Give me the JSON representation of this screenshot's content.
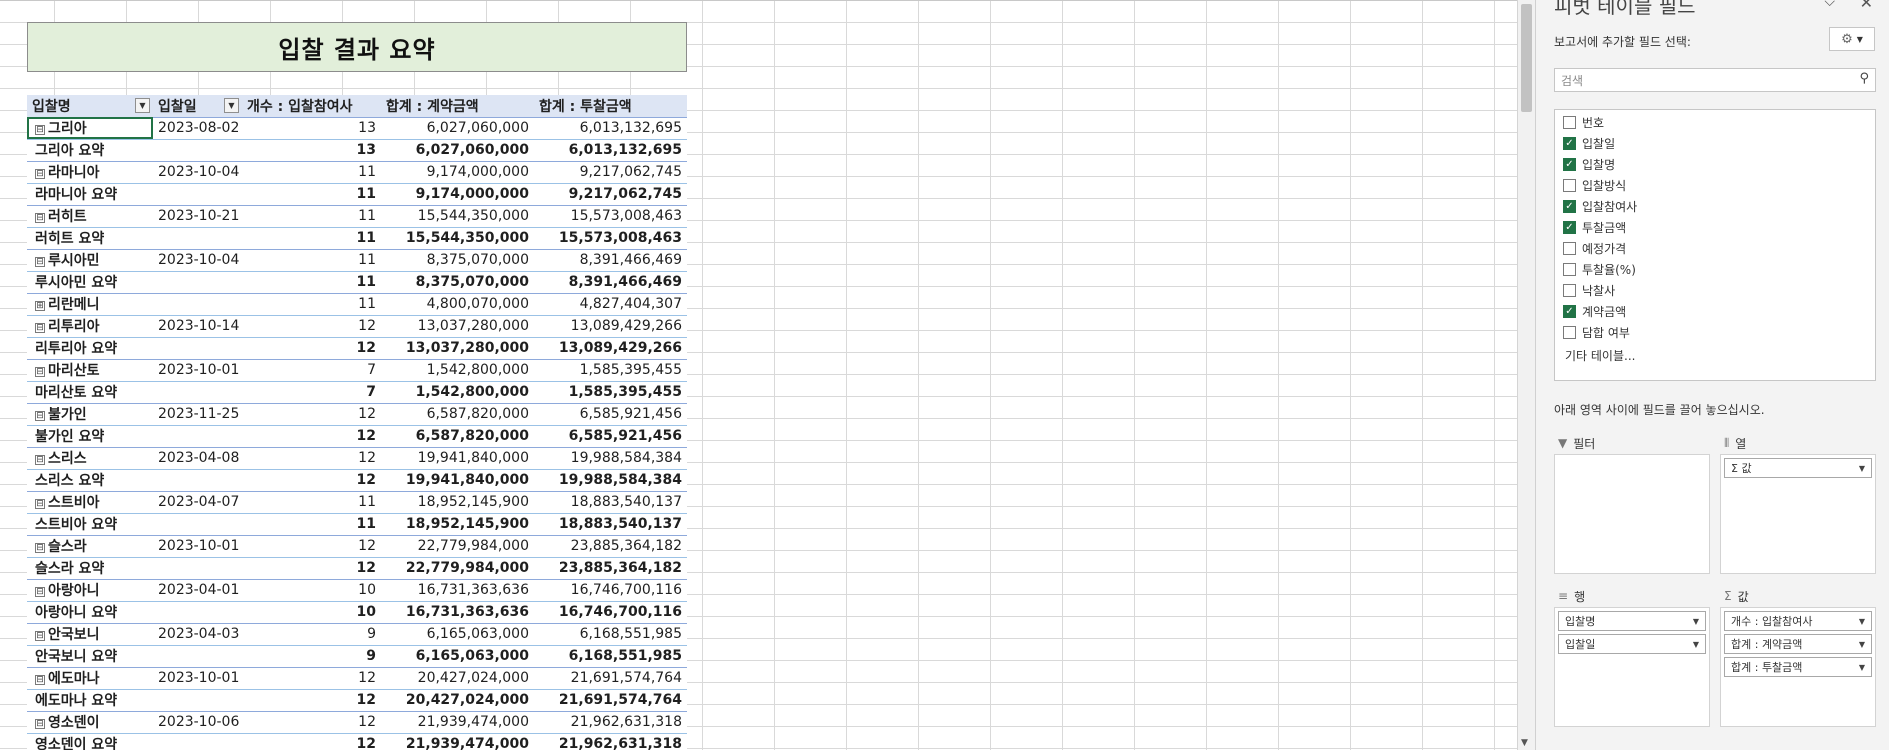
{
  "sheet": {
    "title": "입찰 결과 요약",
    "headers": [
      "입찰명",
      "입찰일",
      "개수 : 입찰참여사",
      "합계 : 계약금액",
      "합계 : 투찰금액"
    ],
    "rows": [
      {
        "type": "detail",
        "name": "그리아",
        "exp": "⊟",
        "date": "2023-08-02",
        "count": "13",
        "contract": "6,027,060,000",
        "bid": "6,013,132,695"
      },
      {
        "type": "sub",
        "name": "그리아 요약",
        "count": "13",
        "contract": "6,027,060,000",
        "bid": "6,013,132,695"
      },
      {
        "type": "detail",
        "name": "라마니아",
        "exp": "⊟",
        "date": "2023-10-04",
        "count": "11",
        "contract": "9,174,000,000",
        "bid": "9,217,062,745"
      },
      {
        "type": "sub",
        "name": "라마니아 요약",
        "count": "11",
        "contract": "9,174,000,000",
        "bid": "9,217,062,745"
      },
      {
        "type": "detail",
        "name": "러히트",
        "exp": "⊟",
        "date": "2023-10-21",
        "count": "11",
        "contract": "15,544,350,000",
        "bid": "15,573,008,463"
      },
      {
        "type": "sub",
        "name": "러히트 요약",
        "count": "11",
        "contract": "15,544,350,000",
        "bid": "15,573,008,463"
      },
      {
        "type": "detail",
        "name": "루시아민",
        "exp": "⊟",
        "date": "2023-10-04",
        "count": "11",
        "contract": "8,375,070,000",
        "bid": "8,391,466,469"
      },
      {
        "type": "sub",
        "name": "루시아민 요약",
        "count": "11",
        "contract": "8,375,070,000",
        "bid": "8,391,466,469"
      },
      {
        "type": "detail",
        "name": "리란메니",
        "exp": "⊞",
        "date": "",
        "count": "11",
        "contract": "4,800,070,000",
        "bid": "4,827,404,307"
      },
      {
        "type": "detail",
        "name": "리투리아",
        "exp": "⊟",
        "date": "2023-10-14",
        "count": "12",
        "contract": "13,037,280,000",
        "bid": "13,089,429,266"
      },
      {
        "type": "sub",
        "name": "리투리아 요약",
        "count": "12",
        "contract": "13,037,280,000",
        "bid": "13,089,429,266"
      },
      {
        "type": "detail",
        "name": "마리산토",
        "exp": "⊟",
        "date": "2023-10-01",
        "count": "7",
        "contract": "1,542,800,000",
        "bid": "1,585,395,455"
      },
      {
        "type": "sub",
        "name": "마리산토 요약",
        "count": "7",
        "contract": "1,542,800,000",
        "bid": "1,585,395,455"
      },
      {
        "type": "detail",
        "name": "불가인",
        "exp": "⊟",
        "date": "2023-11-25",
        "count": "12",
        "contract": "6,587,820,000",
        "bid": "6,585,921,456"
      },
      {
        "type": "sub",
        "name": "불가인 요약",
        "count": "12",
        "contract": "6,587,820,000",
        "bid": "6,585,921,456"
      },
      {
        "type": "detail",
        "name": "스리스",
        "exp": "⊟",
        "date": "2023-04-08",
        "count": "12",
        "contract": "19,941,840,000",
        "bid": "19,988,584,384"
      },
      {
        "type": "sub",
        "name": "스리스 요약",
        "count": "12",
        "contract": "19,941,840,000",
        "bid": "19,988,584,384"
      },
      {
        "type": "detail",
        "name": "스트비아",
        "exp": "⊟",
        "date": "2023-04-07",
        "count": "11",
        "contract": "18,952,145,900",
        "bid": "18,883,540,137"
      },
      {
        "type": "sub",
        "name": "스트비아 요약",
        "count": "11",
        "contract": "18,952,145,900",
        "bid": "18,883,540,137"
      },
      {
        "type": "detail",
        "name": "슬스라",
        "exp": "⊟",
        "date": "2023-10-01",
        "count": "12",
        "contract": "22,779,984,000",
        "bid": "23,885,364,182"
      },
      {
        "type": "sub",
        "name": "슬스라 요약",
        "count": "12",
        "contract": "22,779,984,000",
        "bid": "23,885,364,182"
      },
      {
        "type": "detail",
        "name": "아랑아니",
        "exp": "⊟",
        "date": "2023-04-01",
        "count": "10",
        "contract": "16,731,363,636",
        "bid": "16,746,700,116"
      },
      {
        "type": "sub",
        "name": "아랑아니 요약",
        "count": "10",
        "contract": "16,731,363,636",
        "bid": "16,746,700,116"
      },
      {
        "type": "detail",
        "name": "안국보니",
        "exp": "⊟",
        "date": "2023-04-03",
        "count": "9",
        "contract": "6,165,063,000",
        "bid": "6,168,551,985"
      },
      {
        "type": "sub",
        "name": "안국보니 요약",
        "count": "9",
        "contract": "6,165,063,000",
        "bid": "6,168,551,985"
      },
      {
        "type": "detail",
        "name": "에도마나",
        "exp": "⊟",
        "date": "2023-10-01",
        "count": "12",
        "contract": "20,427,024,000",
        "bid": "21,691,574,764"
      },
      {
        "type": "sub",
        "name": "에도마나 요약",
        "count": "12",
        "contract": "20,427,024,000",
        "bid": "21,691,574,764"
      },
      {
        "type": "detail",
        "name": "영소덴이",
        "exp": "⊟",
        "date": "2023-10-06",
        "count": "12",
        "contract": "21,939,474,000",
        "bid": "21,962,631,318"
      },
      {
        "type": "sub",
        "name": "영소덴이 요약",
        "count": "12",
        "contract": "21,939,474,000",
        "bid": "21,962,631,318"
      }
    ]
  },
  "pane": {
    "title": "피벗 테이블 필드",
    "choose_label": "보고서에 추가할 필드 선택:",
    "search_placeholder": "검색",
    "fields": [
      {
        "label": "번호",
        "checked": false
      },
      {
        "label": "입찰일",
        "checked": true
      },
      {
        "label": "입찰명",
        "checked": true
      },
      {
        "label": "입찰방식",
        "checked": false
      },
      {
        "label": "입찰참여사",
        "checked": true
      },
      {
        "label": "투찰금액",
        "checked": true
      },
      {
        "label": "예정가격",
        "checked": false
      },
      {
        "label": "투찰율(%)",
        "checked": false
      },
      {
        "label": "낙찰사",
        "checked": false
      },
      {
        "label": "계약금액",
        "checked": true
      },
      {
        "label": "담합 여부",
        "checked": false
      }
    ],
    "more_tables": "기타 테이블...",
    "drag_label": "아래 영역 사이에 필드를 끌어 놓으십시오.",
    "areas": {
      "filter": {
        "label": "필터",
        "items": []
      },
      "columns": {
        "label": "열",
        "items": [
          "Σ 값"
        ]
      },
      "rows": {
        "label": "행",
        "items": [
          "입찰명",
          "입찰일"
        ]
      },
      "values": {
        "label": "값",
        "items": [
          "개수 : 입찰참여사",
          "합계 : 계약금액",
          "합계 : 투찰금액"
        ]
      }
    }
  },
  "colors": {
    "title_fill": "#e2efda",
    "header_fill": "#dde5f4",
    "row_line": "#9bc2e6",
    "checkbox_on": "#217346"
  }
}
